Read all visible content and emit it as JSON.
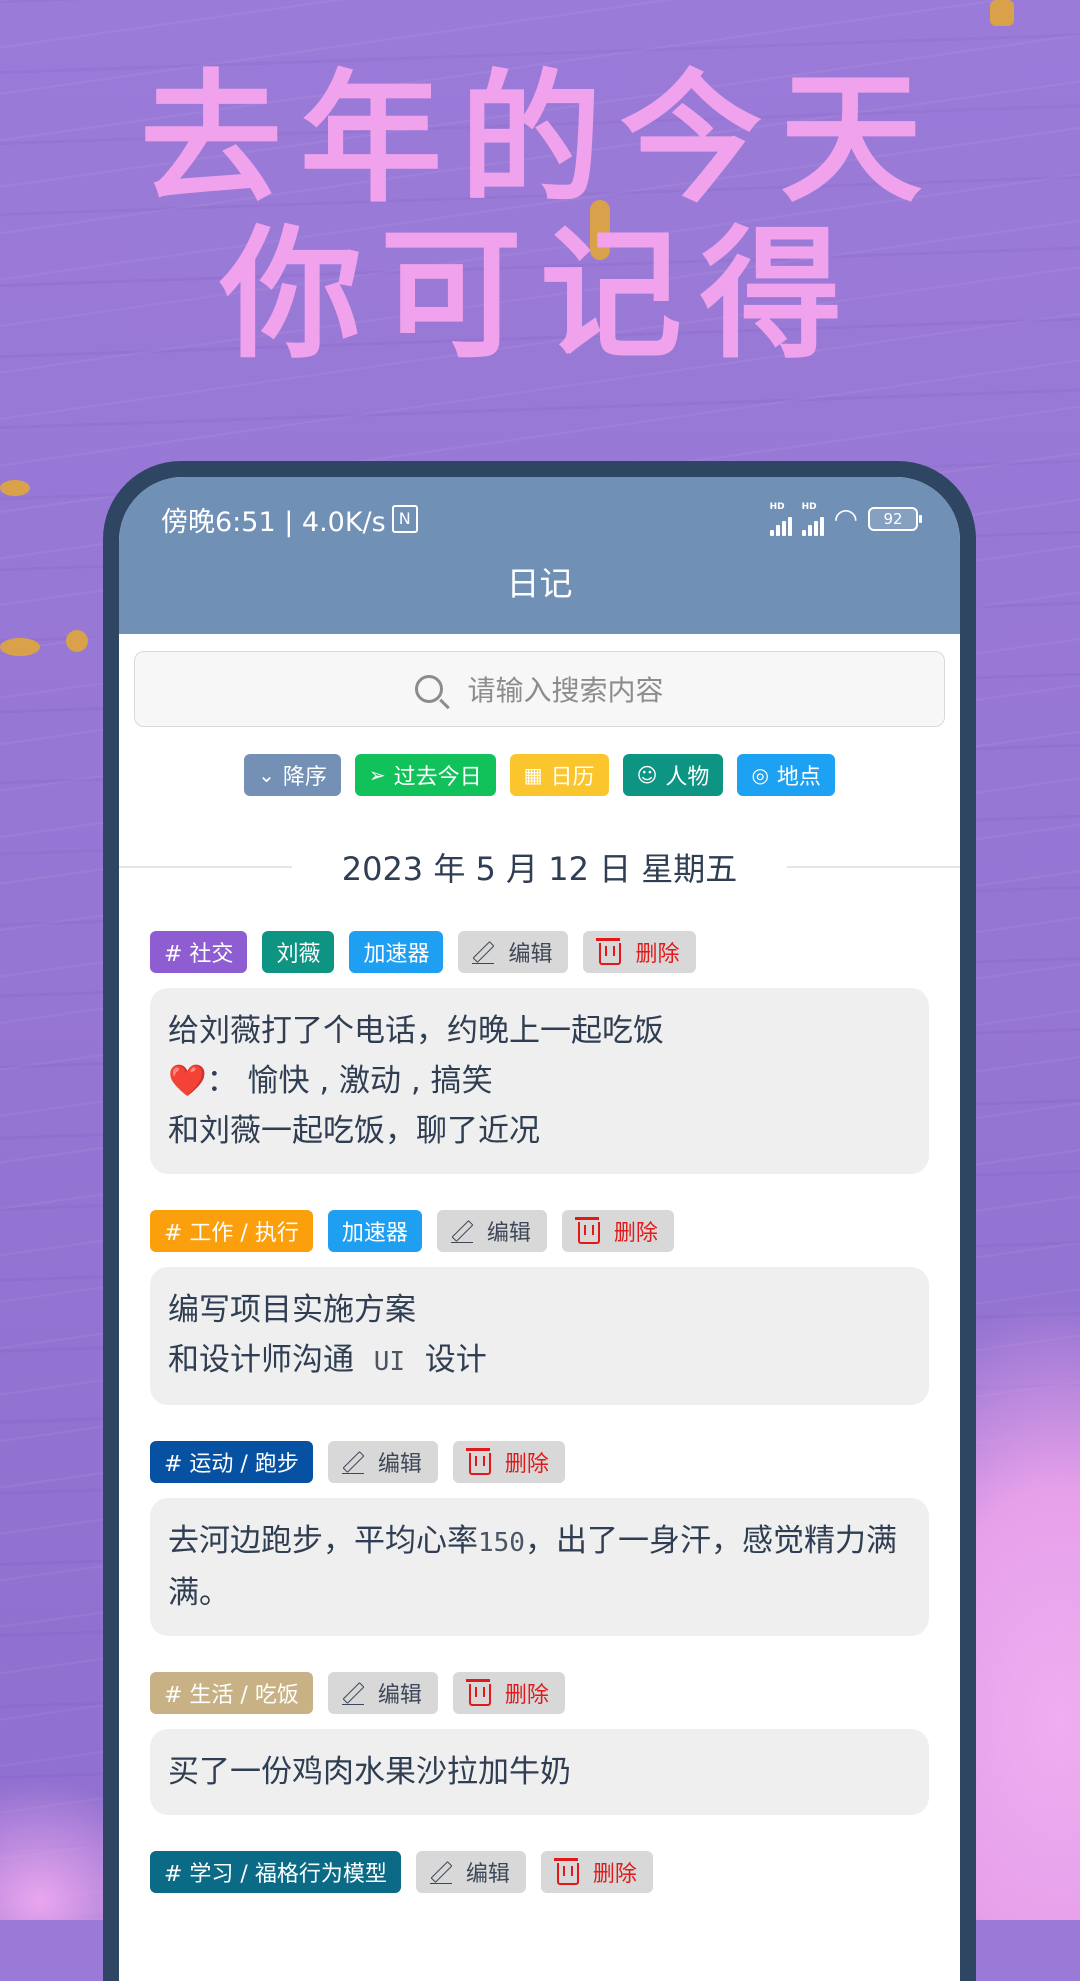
{
  "promo": {
    "headline_line1": "去年的今天",
    "headline_line2": "你可记得"
  },
  "status_bar": {
    "time_and_speed": "傍晚6:51 | 4.0K/s",
    "nfc_icon": "N",
    "signal1_label": "HD",
    "signal2_label": "HD",
    "wifi_icon": "wifi-icon",
    "battery": "92"
  },
  "app": {
    "title": "日记"
  },
  "search": {
    "placeholder": "请输入搜索内容"
  },
  "filters": [
    {
      "label": "降序",
      "icon": "chevron-down-icon",
      "color": "#7590b5"
    },
    {
      "label": "过去今日",
      "icon": "navigation-arrow-icon",
      "color": "#11c15a"
    },
    {
      "label": "日历",
      "icon": "calendar-icon",
      "color": "#fbc52e"
    },
    {
      "label": "人物",
      "icon": "person-icon",
      "color": "#0e9482"
    },
    {
      "label": "地点",
      "icon": "location-pin-icon",
      "color": "#1da1f2"
    }
  ],
  "date_header": "2023 年 5 月 12 日 星期五",
  "actions": {
    "edit_label": "编辑",
    "delete_label": "删除"
  },
  "entries": [
    {
      "tags": [
        {
          "label": "# 社交",
          "color": "#8e5dd1"
        },
        {
          "label": "刘薇",
          "color": "#0e9482"
        },
        {
          "label": "加速器",
          "color": "#1e9ff2"
        }
      ],
      "lines": [
        "给刘薇打了个电话，约晚上一起吃饭",
        "：  愉快 , 激动 , 搞笑",
        "和刘薇一起吃饭，聊了近况"
      ],
      "mood_icon": "❤️"
    },
    {
      "tags": [
        {
          "label": "# 工作 / 执行",
          "color": "#fb9f0c"
        },
        {
          "label": "加速器",
          "color": "#1e9ff2"
        }
      ],
      "lines": [
        "编写项目实施方案",
        "和设计师沟通",
        "UI",
        "设计"
      ]
    },
    {
      "tags": [
        {
          "label": "# 运动 / 跑步",
          "color": "#0751a3"
        }
      ],
      "lines": [
        "去河边跑步，平均心率",
        "150",
        "，出了一身汗，感觉精力满满。"
      ]
    },
    {
      "tags": [
        {
          "label": "# 生活 / 吃饭",
          "color": "#c8b184"
        }
      ],
      "lines": [
        "买了一份鸡肉水果沙拉加牛奶"
      ]
    },
    {
      "tags": [
        {
          "label": "# 学习 / 福格行为模型",
          "color": "#0b6a85"
        }
      ],
      "lines": []
    }
  ]
}
